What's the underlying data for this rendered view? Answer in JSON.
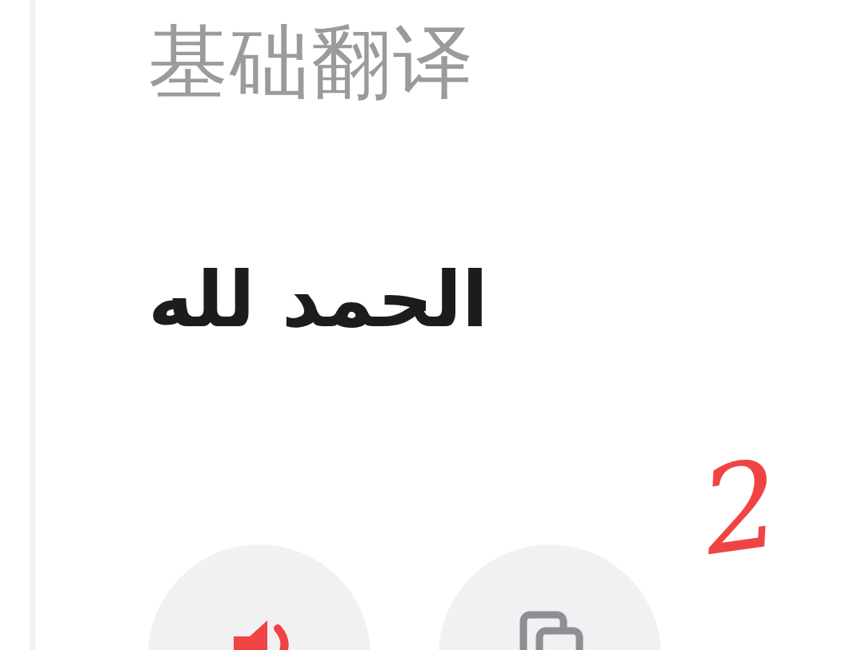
{
  "section_title": "基础翻译",
  "translation": "الحمد لله",
  "actions": [
    {
      "kind": "speak",
      "playing": true
    },
    {
      "kind": "copy",
      "playing": false
    }
  ],
  "annotation": "2"
}
